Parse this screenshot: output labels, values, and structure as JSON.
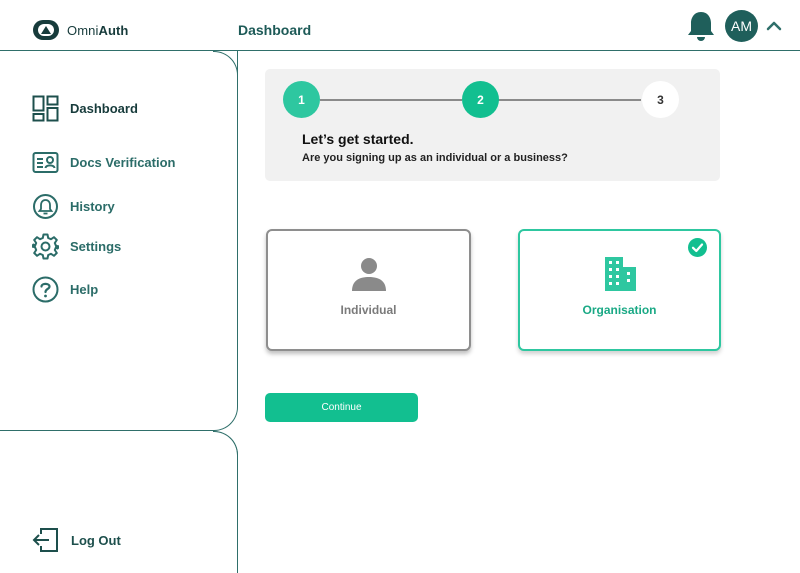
{
  "app": {
    "name_bold_left": "Omni",
    "name_bold_right": "Auth"
  },
  "header": {
    "title": "Dashboard",
    "avatar_initials": "AM"
  },
  "sidebar": {
    "items": [
      {
        "label": "Dashboard",
        "icon": "dashboard-grid-icon"
      },
      {
        "label": "Docs Verification",
        "icon": "id-card-icon"
      },
      {
        "label": "History",
        "icon": "bell-circle-icon"
      },
      {
        "label": "Settings",
        "icon": "gear-icon"
      },
      {
        "label": "Help",
        "icon": "question-circle-icon"
      }
    ],
    "logout_label": "Log Out"
  },
  "stepper": {
    "steps": [
      "1",
      "2",
      "3"
    ],
    "current_step": 2,
    "heading": "Let’s get started.",
    "subheading": "Are you signing up as an individual or a business?"
  },
  "choices": {
    "individual_label": "Individual",
    "organisation_label": "Organisation",
    "selected": "Organisation"
  },
  "continue_label": "Continue",
  "colors": {
    "brand_dark": "#1f5f5b",
    "accent": "#12bf90",
    "accent_light": "#2ec7a0",
    "panel_bg": "#f1f1f1"
  }
}
